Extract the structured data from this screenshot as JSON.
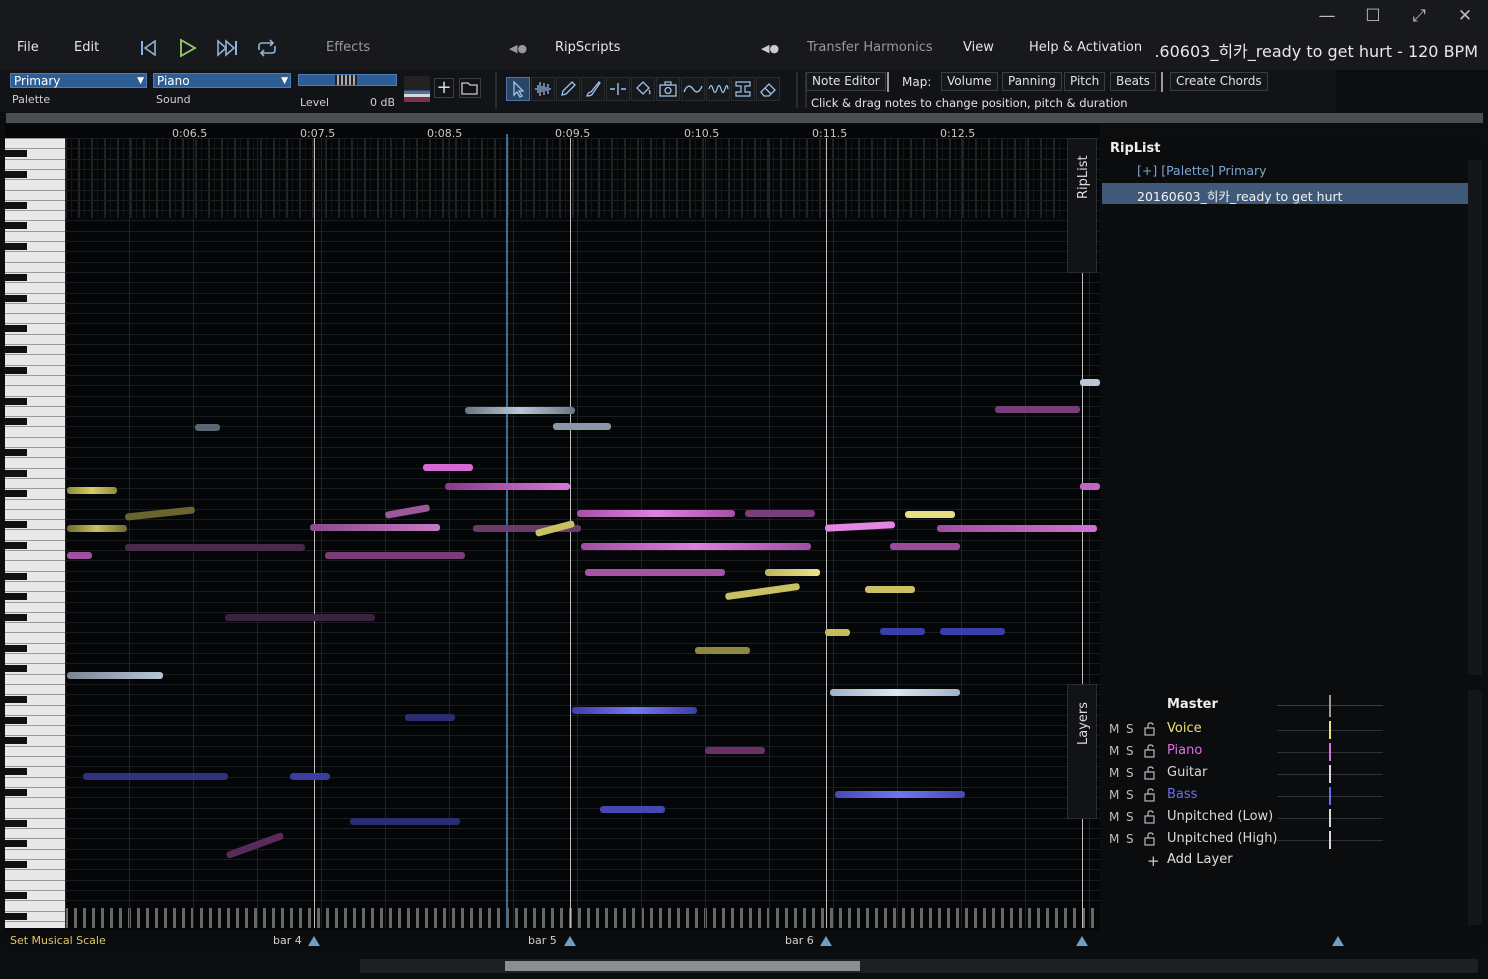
{
  "window": {
    "title": ".60603_히카_ready to get hurt - 120 BPM",
    "controls": [
      "minimize",
      "maximize",
      "fullscreen",
      "close"
    ]
  },
  "menu": {
    "file": "File",
    "edit": "Edit",
    "effects": "Effects",
    "ripscripts": "RipScripts",
    "transfer_harmonics": "Transfer Harmonics",
    "view": "View",
    "help": "Help & Activation"
  },
  "toolbar": {
    "palette_value": "Primary",
    "palette_label": "Palette",
    "sound_value": "Piano",
    "sound_label": "Sound",
    "level_label": "Level",
    "level_value": "0 dB",
    "note_editor": "Note Editor",
    "map_label": "Map:",
    "volume": "Volume",
    "panning": "Panning",
    "pitch": "Pitch",
    "beats": "Beats",
    "create_chords": "Create Chords",
    "hint": "Click & drag notes to change position, pitch & duration",
    "tools": [
      "select-icon",
      "waveform-icon",
      "pencil-icon",
      "brush-icon",
      "split-icon",
      "fill-icon",
      "camera-icon",
      "vibrato-icon",
      "wave-icon",
      "stamp-icon",
      "eraser-icon"
    ]
  },
  "timeline": {
    "ticks": [
      "0:06.5",
      "0:07.5",
      "0:08.5",
      "0:09.5",
      "0:10.5",
      "0:11.5",
      "0:12.5"
    ]
  },
  "riplist": {
    "title": "RipList",
    "tab": "RipList",
    "items": [
      "[+] [Palette] Primary",
      "20160603_히카_ready to get hurt"
    ]
  },
  "layers": {
    "tab": "Layers",
    "master": "Master",
    "rows": [
      {
        "name": "Voice",
        "color": "#e8e27a"
      },
      {
        "name": "Piano",
        "color": "#e66be6"
      },
      {
        "name": "Guitar",
        "color": "#d8d8d8"
      },
      {
        "name": "Bass",
        "color": "#6a6ef0"
      },
      {
        "name": "Unpitched (Low)",
        "color": "#d8d8d8"
      },
      {
        "name": "Unpitched (High)",
        "color": "#d8d8d8"
      }
    ],
    "m": "M",
    "s": "S",
    "add_layer": "Add Layer"
  },
  "bottom": {
    "scale": "Set Musical Scale",
    "bars": [
      "bar 4",
      "bar 5",
      "bar 6"
    ]
  },
  "colors": {
    "accent": "#2d5d93",
    "voice": "#e8e27a",
    "piano": "#e66be6",
    "guitar": "#b7c7d8",
    "bass": "#5a5ee0"
  }
}
